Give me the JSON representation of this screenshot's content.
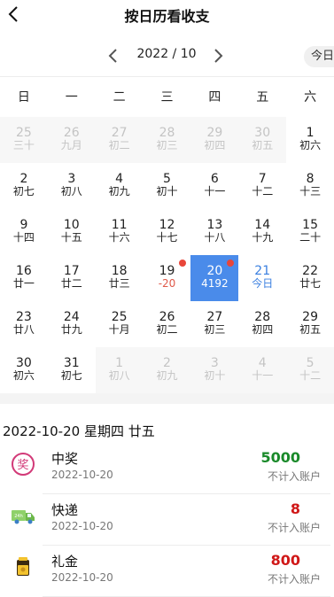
{
  "header": {
    "title": "按日历看收支"
  },
  "month_nav": {
    "label": "2022 / 10",
    "today_label": "今日"
  },
  "weekdays": [
    "日",
    "一",
    "二",
    "三",
    "四",
    "五",
    "六"
  ],
  "days": [
    {
      "d": "25",
      "s": "三十",
      "state": "dim"
    },
    {
      "d": "26",
      "s": "九月",
      "state": "dim"
    },
    {
      "d": "27",
      "s": "初二",
      "state": "dim"
    },
    {
      "d": "28",
      "s": "初三",
      "state": "dim"
    },
    {
      "d": "29",
      "s": "初四",
      "state": "dim"
    },
    {
      "d": "30",
      "s": "初五",
      "state": "dim"
    },
    {
      "d": "1",
      "s": "初六",
      "state": ""
    },
    {
      "d": "2",
      "s": "初七",
      "state": ""
    },
    {
      "d": "3",
      "s": "初八",
      "state": ""
    },
    {
      "d": "4",
      "s": "初九",
      "state": ""
    },
    {
      "d": "5",
      "s": "初十",
      "state": ""
    },
    {
      "d": "6",
      "s": "十一",
      "state": ""
    },
    {
      "d": "7",
      "s": "十二",
      "state": ""
    },
    {
      "d": "8",
      "s": "十三",
      "state": ""
    },
    {
      "d": "9",
      "s": "十四",
      "state": ""
    },
    {
      "d": "10",
      "s": "十五",
      "state": ""
    },
    {
      "d": "11",
      "s": "十六",
      "state": ""
    },
    {
      "d": "12",
      "s": "十七",
      "state": ""
    },
    {
      "d": "13",
      "s": "十八",
      "state": ""
    },
    {
      "d": "14",
      "s": "十九",
      "state": ""
    },
    {
      "d": "15",
      "s": "二十",
      "state": ""
    },
    {
      "d": "16",
      "s": "廿一",
      "state": ""
    },
    {
      "d": "17",
      "s": "廿二",
      "state": ""
    },
    {
      "d": "18",
      "s": "廿三",
      "state": ""
    },
    {
      "d": "19",
      "s": "-20",
      "state": "red-sub",
      "dot": true
    },
    {
      "d": "20",
      "s": "4192",
      "state": "selected",
      "dot": true
    },
    {
      "d": "21",
      "s": "今日",
      "state": "today"
    },
    {
      "d": "22",
      "s": "廿七",
      "state": ""
    },
    {
      "d": "23",
      "s": "廿八",
      "state": ""
    },
    {
      "d": "24",
      "s": "廿九",
      "state": ""
    },
    {
      "d": "25",
      "s": "十月",
      "state": ""
    },
    {
      "d": "26",
      "s": "初二",
      "state": ""
    },
    {
      "d": "27",
      "s": "初三",
      "state": ""
    },
    {
      "d": "28",
      "s": "初四",
      "state": ""
    },
    {
      "d": "29",
      "s": "初五",
      "state": ""
    },
    {
      "d": "30",
      "s": "初六",
      "state": ""
    },
    {
      "d": "31",
      "s": "初七",
      "state": ""
    },
    {
      "d": "1",
      "s": "初八",
      "state": "dim"
    },
    {
      "d": "2",
      "s": "初九",
      "state": "dim"
    },
    {
      "d": "3",
      "s": "初十",
      "state": "dim"
    },
    {
      "d": "4",
      "s": "十一",
      "state": "dim"
    },
    {
      "d": "5",
      "s": "十二",
      "state": "dim"
    }
  ],
  "selected_day": {
    "title": "2022-10-20 星期四 廿五"
  },
  "records": [
    {
      "name": "中奖",
      "date": "2022-10-20",
      "amount": "5000",
      "amount_color": "#1a8a2a",
      "account": "不计入账户",
      "icon": "prize-icon"
    },
    {
      "name": "快递",
      "date": "2022-10-20",
      "amount": "8",
      "amount_color": "#d01818",
      "account": "不计入账户",
      "icon": "delivery-truck-icon"
    },
    {
      "name": "礼金",
      "date": "2022-10-20",
      "amount": "800",
      "amount_color": "#d01818",
      "account": "不计入账户",
      "icon": "gift-money-icon"
    }
  ]
}
